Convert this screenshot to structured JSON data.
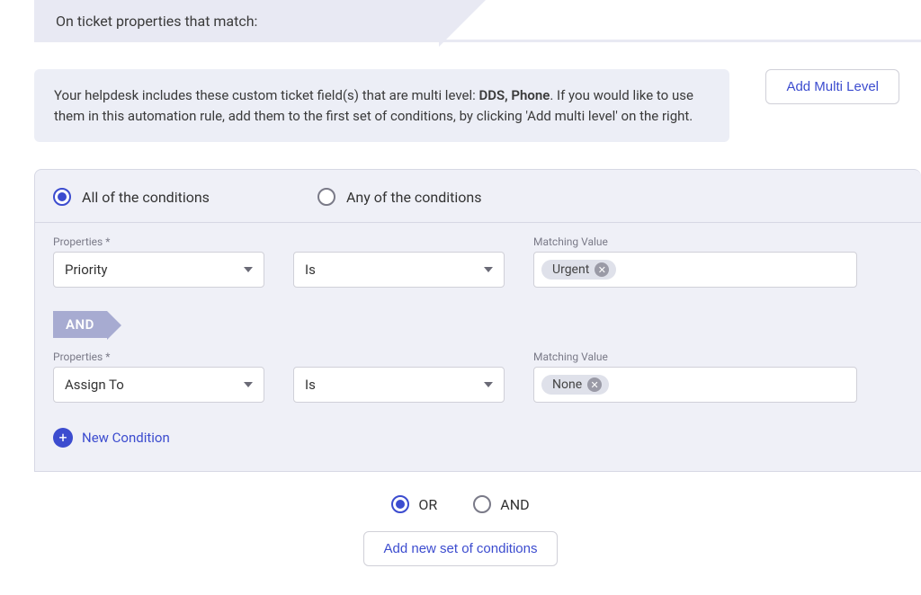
{
  "header": {
    "title": "On ticket properties that match:"
  },
  "info": {
    "text_before": "Your helpdesk includes these custom ticket field(s) that are multi level: ",
    "bold": "DDS, Phone",
    "text_after": ". If you would like to use them in this automation rule, add them to the first set of conditions, by clicking 'Add multi level' on the right.",
    "button": "Add Multi Level"
  },
  "match": {
    "all_label": "All of the conditions",
    "any_label": "Any of the conditions",
    "selected": "all"
  },
  "labels": {
    "properties": "Properties *",
    "matching_value": "Matching Value"
  },
  "rows": [
    {
      "property": "Priority",
      "operator": "Is",
      "value": "Urgent"
    },
    {
      "property": "Assign To",
      "operator": "Is",
      "value": "None"
    }
  ],
  "logic_between_rows": "AND",
  "new_condition": "New Condition",
  "set_logic": {
    "or": "OR",
    "and": "AND",
    "selected": "or"
  },
  "add_set_button": "Add new set of conditions"
}
